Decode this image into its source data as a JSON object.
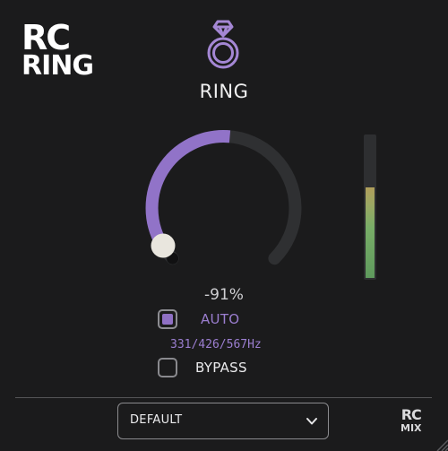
{
  "logo": {
    "line1": "RC",
    "line2": "RING"
  },
  "plugin": {
    "title": "RING",
    "icon": "ring-icon"
  },
  "knob": {
    "readout": "-91%",
    "arc_color": "#9173c8"
  },
  "meter": {
    "level": 0.64
  },
  "auto": {
    "label": "AUTO",
    "checked": true,
    "frequencies": "331/426/567Hz"
  },
  "bypass": {
    "label": "BYPASS",
    "checked": false
  },
  "preset": {
    "selected": "DEFAULT"
  },
  "brand": {
    "line1": "RC",
    "line2": "MIX"
  },
  "colors": {
    "accent": "#9173c8",
    "background": "#1b1b1c",
    "track": "#2e2f31"
  }
}
